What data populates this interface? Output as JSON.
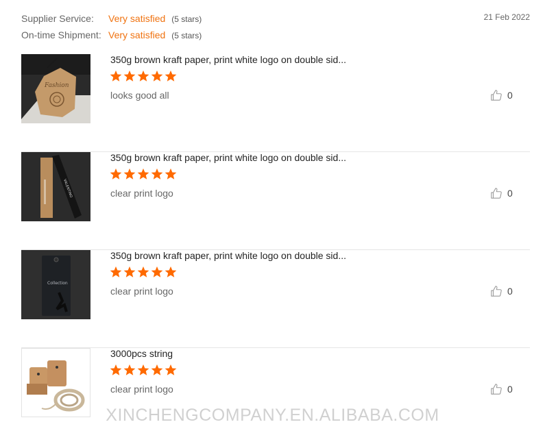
{
  "summary": {
    "supplier_label": "Supplier Service:",
    "supplier_value": "Very satisfied",
    "supplier_stars": "(5 stars)",
    "shipment_label": "On-time Shipment:",
    "shipment_value": "Very satisfied",
    "shipment_stars": "(5 stars)",
    "date": "21 Feb 2022"
  },
  "reviews": [
    {
      "title": "350g brown kraft paper, print white logo on double sid...",
      "rating": 5,
      "comment": "looks good all",
      "likes": "0",
      "image": "fashion-kraft-hang-tag"
    },
    {
      "title": "350g brown kraft paper, print white logo on double sid...",
      "rating": 5,
      "comment": "clear print logo",
      "likes": "0",
      "image": "black-kraft-hang-tag"
    },
    {
      "title": "350g brown kraft paper, print white logo on double sid...",
      "rating": 5,
      "comment": "clear print logo",
      "likes": "0",
      "image": "black-collection-tag"
    },
    {
      "title": "3000pcs string",
      "rating": 5,
      "comment": "clear print logo",
      "likes": "0",
      "image": "kraft-tags-with-string"
    }
  ],
  "watermark": "XINCHENGCOMPANY.EN.ALIBABA.COM",
  "colors": {
    "accent": "#f0720f",
    "star": "#ff6a00"
  },
  "icons": {
    "star": "star-icon",
    "like": "thumbs-up-icon"
  }
}
